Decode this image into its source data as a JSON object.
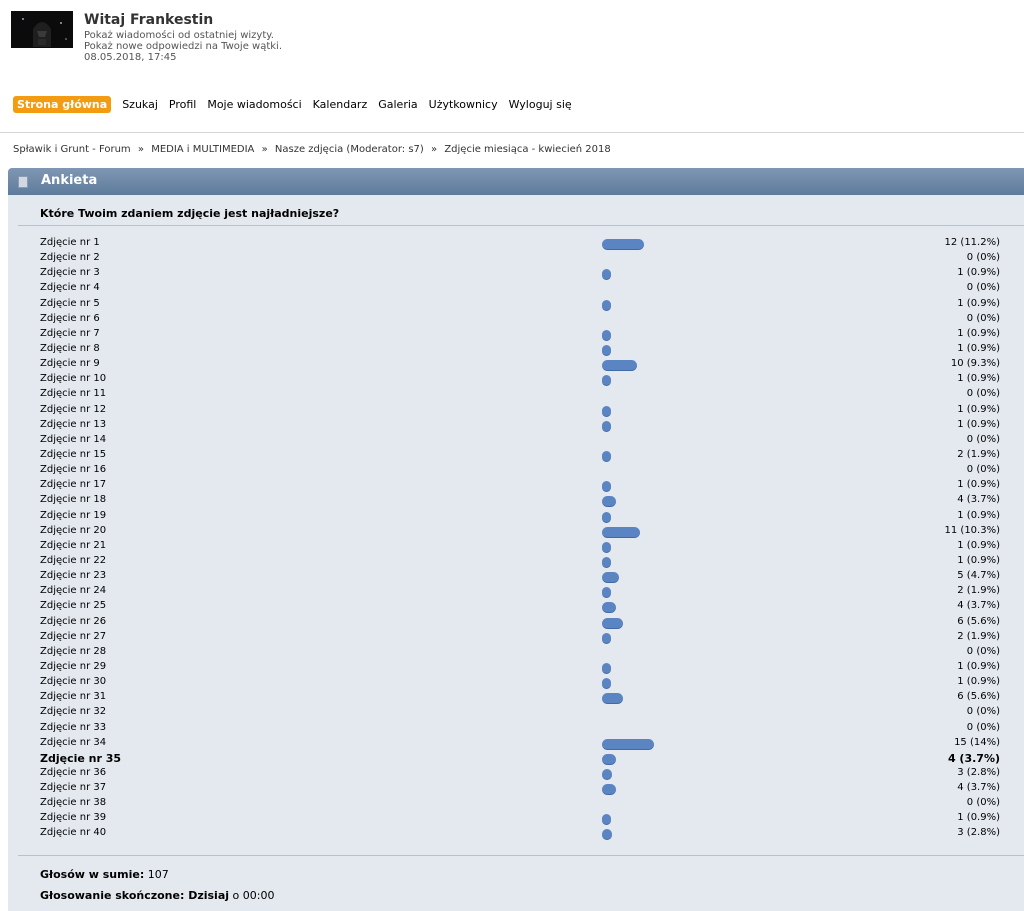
{
  "header": {
    "title": "Witaj Frankestin",
    "line1": "Pokaż wiadomości od ostatniej wizyty.",
    "line2": "Pokaż nowe odpowiedzi na Twoje wątki.",
    "datetime": "08.05.2018, 17:45"
  },
  "nav": {
    "items": [
      {
        "label": "Strona główna",
        "active": true
      },
      {
        "label": "Szukaj"
      },
      {
        "label": "Profil"
      },
      {
        "label": "Moje wiadomości"
      },
      {
        "label": "Kalendarz"
      },
      {
        "label": "Galeria"
      },
      {
        "label": "Użytkownicy"
      },
      {
        "label": "Wyloguj się"
      }
    ]
  },
  "breadcrumb": {
    "items": [
      "Spławik i Grunt - Forum",
      "MEDIA i MULTIMEDIA",
      "Nasze zdjęcia (Moderator: s7)",
      "Zdjęcie miesiąca - kwiecień 2018"
    ],
    "separator": "»"
  },
  "poll": {
    "header_title": "Ankieta",
    "question": "Które Twoim zdaniem zdjęcie jest najładniejsze?",
    "options": [
      {
        "label": "Zdjęcie nr 1",
        "votes": 12,
        "count_text": "12 (11.2%)"
      },
      {
        "label": "Zdjęcie nr 2",
        "votes": 0,
        "count_text": "0 (0%)"
      },
      {
        "label": "Zdjęcie nr 3",
        "votes": 1,
        "count_text": "1 (0.9%)"
      },
      {
        "label": "Zdjęcie nr 4",
        "votes": 0,
        "count_text": "0 (0%)"
      },
      {
        "label": "Zdjęcie nr 5",
        "votes": 1,
        "count_text": "1 (0.9%)"
      },
      {
        "label": "Zdjęcie nr 6",
        "votes": 0,
        "count_text": "0 (0%)"
      },
      {
        "label": "Zdjęcie nr 7",
        "votes": 1,
        "count_text": "1 (0.9%)"
      },
      {
        "label": "Zdjęcie nr 8",
        "votes": 1,
        "count_text": "1 (0.9%)"
      },
      {
        "label": "Zdjęcie nr 9",
        "votes": 10,
        "count_text": "10 (9.3%)"
      },
      {
        "label": "Zdjęcie nr 10",
        "votes": 1,
        "count_text": "1 (0.9%)"
      },
      {
        "label": "Zdjęcie nr 11",
        "votes": 0,
        "count_text": "0 (0%)"
      },
      {
        "label": "Zdjęcie nr 12",
        "votes": 1,
        "count_text": "1 (0.9%)"
      },
      {
        "label": "Zdjęcie nr 13",
        "votes": 1,
        "count_text": "1 (0.9%)"
      },
      {
        "label": "Zdjęcie nr 14",
        "votes": 0,
        "count_text": "0 (0%)"
      },
      {
        "label": "Zdjęcie nr 15",
        "votes": 2,
        "count_text": "2 (1.9%)"
      },
      {
        "label": "Zdjęcie nr 16",
        "votes": 0,
        "count_text": "0 (0%)"
      },
      {
        "label": "Zdjęcie nr 17",
        "votes": 1,
        "count_text": "1 (0.9%)"
      },
      {
        "label": "Zdjęcie nr 18",
        "votes": 4,
        "count_text": "4 (3.7%)"
      },
      {
        "label": "Zdjęcie nr 19",
        "votes": 1,
        "count_text": "1 (0.9%)"
      },
      {
        "label": "Zdjęcie nr 20",
        "votes": 11,
        "count_text": "11 (10.3%)"
      },
      {
        "label": "Zdjęcie nr 21",
        "votes": 1,
        "count_text": "1 (0.9%)"
      },
      {
        "label": "Zdjęcie nr 22",
        "votes": 1,
        "count_text": "1 (0.9%)"
      },
      {
        "label": "Zdjęcie nr 23",
        "votes": 5,
        "count_text": "5 (4.7%)"
      },
      {
        "label": "Zdjęcie nr 24",
        "votes": 2,
        "count_text": "2 (1.9%)"
      },
      {
        "label": "Zdjęcie nr 25",
        "votes": 4,
        "count_text": "4 (3.7%)"
      },
      {
        "label": "Zdjęcie nr 26",
        "votes": 6,
        "count_text": "6 (5.6%)"
      },
      {
        "label": "Zdjęcie nr 27",
        "votes": 2,
        "count_text": "2 (1.9%)"
      },
      {
        "label": "Zdjęcie nr 28",
        "votes": 0,
        "count_text": "0 (0%)"
      },
      {
        "label": "Zdjęcie nr 29",
        "votes": 1,
        "count_text": "1 (0.9%)"
      },
      {
        "label": "Zdjęcie nr 30",
        "votes": 1,
        "count_text": "1 (0.9%)"
      },
      {
        "label": "Zdjęcie nr 31",
        "votes": 6,
        "count_text": "6 (5.6%)"
      },
      {
        "label": "Zdjęcie nr 32",
        "votes": 0,
        "count_text": "0 (0%)"
      },
      {
        "label": "Zdjęcie nr 33",
        "votes": 0,
        "count_text": "0 (0%)"
      },
      {
        "label": "Zdjęcie nr 34",
        "votes": 15,
        "count_text": "15 (14%)"
      },
      {
        "label": "Zdjęcie nr 35",
        "votes": 4,
        "count_text": "4 (3.7%)",
        "highlight": true
      },
      {
        "label": "Zdjęcie nr 36",
        "votes": 3,
        "count_text": "3 (2.8%)"
      },
      {
        "label": "Zdjęcie nr 37",
        "votes": 4,
        "count_text": "4 (3.7%)"
      },
      {
        "label": "Zdjęcie nr 38",
        "votes": 0,
        "count_text": "0 (0%)"
      },
      {
        "label": "Zdjęcie nr 39",
        "votes": 1,
        "count_text": "1 (0.9%)"
      },
      {
        "label": "Zdjęcie nr 40",
        "votes": 3,
        "count_text": "3 (2.8%)"
      }
    ],
    "total_label": "Głosów w sumie:",
    "total_value": "107",
    "ended_label": "Głosowanie skończone: Dzisiaj",
    "ended_time": "o 00:00"
  },
  "colors": {
    "accent": "#f39c12",
    "bar": "#5b85c2",
    "panel_header": "#6d89aa",
    "panel_body": "#e4e8ef"
  },
  "icons": {
    "panel_icon": "poll-icon"
  }
}
